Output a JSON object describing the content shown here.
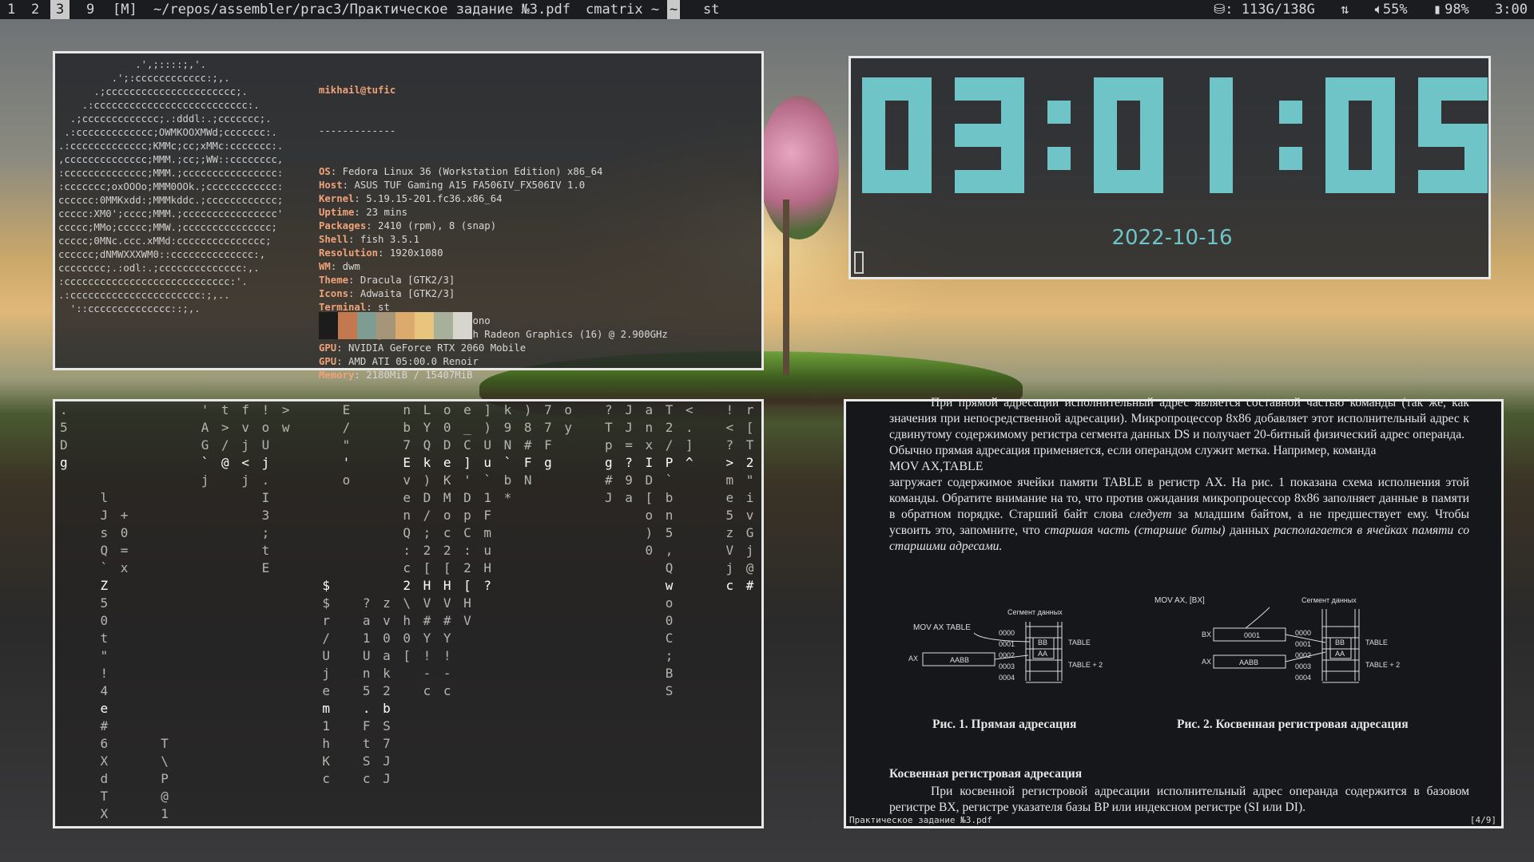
{
  "topbar": {
    "tags": [
      "1",
      "2",
      "3",
      "9"
    ],
    "selected_tag": "3",
    "layout": "[M]",
    "window_titles": [
      "~/repos/assembler/prac3/Практическое задание №3.pdf",
      "cmatrix ~",
      "~",
      "st"
    ],
    "selected_title": "~",
    "status": {
      "disk": "113G/138G",
      "volume": "55%",
      "battery": "98%",
      "time": "3:00"
    }
  },
  "neofetch": {
    "logo_lines": [
      "             .',;::::;,'.",
      "         .';:cccccccccccc:;,.",
      "      .;cccccccccccccccccccccc;.",
      "    .:cccccccccccccccccccccccccc:.",
      "  .;ccccccccccccc;.:dddl:.;ccccccc;.",
      " .:ccccccccccccc;OWMKOOXMWd;ccccccc:.",
      ".:ccccccccccccc;KMMc;cc;xMMc:ccccccc:.",
      ",cccccccccccccc;MMM.;cc;;WW::cccccccc,",
      ":cccccccccccccc;MMM.;cccccccccccccccc:",
      ":ccccccc;oxOOOo;MMM0OOk.;cccccccccccc:",
      "cccccc:0MMKxdd:;MMMkddc.;cccccccccccc;",
      "ccccc:XM0';cccc;MMM.;cccccccccccccccc'",
      "ccccc;MMo;ccccc;MMW.;ccccccccccccccc;",
      "ccccc;0MNc.ccc.xMMd:ccccccccccccccc;",
      "cccccc;dNMWXXXWM0::cccccccccccccc:,",
      "cccccccc;.:odl:.;cccccccccccccc:,.",
      ":cccccccccccccccccccccccccccc:'.",
      ".:cccccccccccccccccccccc:;,..",
      "  '::cccccccccccccc::;,."
    ],
    "user_host": "mikhail@tufic",
    "separator": "-------------",
    "fields": [
      {
        "key": "OS",
        "value": "Fedora Linux 36 (Workstation Edition) x86_64"
      },
      {
        "key": "Host",
        "value": "ASUS TUF Gaming A15 FA506IV_FX506IV 1.0"
      },
      {
        "key": "Kernel",
        "value": "5.19.15-201.fc36.x86_64"
      },
      {
        "key": "Uptime",
        "value": "23 mins"
      },
      {
        "key": "Packages",
        "value": "2410 (rpm), 8 (snap)"
      },
      {
        "key": "Shell",
        "value": "fish 3.5.1"
      },
      {
        "key": "Resolution",
        "value": "1920x1080"
      },
      {
        "key": "WM",
        "value": "dwm"
      },
      {
        "key": "Theme",
        "value": "Dracula [GTK2/3]"
      },
      {
        "key": "Icons",
        "value": "Adwaita [GTK2/3]"
      },
      {
        "key": "Terminal",
        "value": "st"
      },
      {
        "key": "Terminal Font",
        "value": "DejaVuSansMono"
      },
      {
        "key": "CPU",
        "value": "AMD Ryzen 7 4800H with Radeon Graphics (16) @ 2.900GHz"
      },
      {
        "key": "GPU",
        "value": "NVIDIA GeForce RTX 2060 Mobile"
      },
      {
        "key": "GPU",
        "value": "AMD ATI 05:00.0 Renoir"
      },
      {
        "key": "Memory",
        "value": "2180MiB / 15407MiB"
      }
    ],
    "palette": [
      "#1c1c1c",
      "#c3784d",
      "#7e9c91",
      "#a5967a",
      "#dcaa6c",
      "#e8c47c",
      "#a6b09a",
      "#d6d6ce"
    ]
  },
  "clock": {
    "time": "03:01:05",
    "date": "2022-10-16",
    "color": "#6fc4c7"
  },
  "matrix": {
    "columns": [
      ". 5 D g",
      "",
      "     l J s Q ` Z 5 0 t \" ! 4 e # 6 X d T X '",
      "      + 0 = x",
      "",
      "                   T \\ P @ 1 E \\",
      "",
      "' A G ` j",
      "t > / @",
      "f v j < j",
      "! o U j . I 3 ; t E",
      "> w",
      "",
      "          $ $ r / U j e m 1 h K c",
      "E / \" ' o",
      "           ? a 1 U n 5 . F t S c",
      "           z v 0 a k 2 b S 7 J J",
      "n b 7 E v e n Q : c 2 \\ h 0 [",
      "L Y Q k ) D / ; 2 [ H V # Y ! - c",
      "o 0 D e K M o c 2 [ H V # Y ! - c",
      "e _ C ] ' D p C : 2 [ H V",
      "] ) U u ` 1 F m u H ? ",
      "k 9 N ` b * ",
      ") 8 # F N",
      "7 7 F g",
      "o y",
      "",
      "? T p g # J",
      "J J = ? 9 a",
      "a n x I D [ o ) 0",
      "T 2 / P ` b n 5 , Q w o 0 C ; B S",
      "< . ] ^",
      "",
      "! < ? > m e 5 z V j c",
      "r [ T 2 \" i v G j @ #"
    ]
  },
  "pdf": {
    "para1": "При прямой адресации исполнительный адрес является составной частью команды (так же, как значения при непосредственной адресации). Микропроцессор 8x86 добавляет этот исполнительный адрес к сдвинутому содержимому регистра сегмента данных DS и получает 20-битный физический адрес операнда.",
    "para2": "Обычно прямая адресация применяется, если операндом служит метка. Например, команда",
    "mov": "MOV AX,TABLE",
    "para3_a": "загружает содержимое ячейки памяти TABLE в регистр AX. На рис. 1 показана схема исполнения этой команды. Обратите внимание на то, что против ожидания микропроцессор 8x86 заполняет данные в памяти в обратном порядке. Старший байт слова ",
    "para3_em1": "следует",
    "para3_b": " за младшим байтом, а не предшествует ему. Чтобы усвоить это, запомните, что ",
    "para3_em2": "старшая часть (старшие биты)",
    "para3_c": " данных ",
    "para3_em3": "располагается в ячейках памяти со старшими адресами.",
    "fig1": {
      "instr": "MOV   AX   TABLE",
      "segment": "Сегмент данных",
      "addrs": [
        "0000",
        "0001",
        "0002",
        "0003",
        "0004"
      ],
      "bb": "BB",
      "aa": "AA",
      "reg": "AX",
      "regval": "AABB",
      "label1": "TABLE",
      "label2": "TABLE + 2"
    },
    "fig2": {
      "instr": "MOV   AX,  [BX]",
      "segment": "Сегмент данных",
      "addrs": [
        "0000",
        "0001",
        "0002",
        "0003",
        "0004"
      ],
      "bb": "BB",
      "aa": "AA",
      "reg1": "BX",
      "reg1val": "0001",
      "reg2": "AX",
      "reg2val": "AABB",
      "label1": "TABLE",
      "label2": "TABLE + 2"
    },
    "caption1": "Рис. 1. Прямая адресация",
    "caption2": "Рис. 2. Косвенная регистровая адресация",
    "section": "Косвенная регистровая адресация",
    "para4": "При косвенной регистровой адресации исполнительный адрес операнда содержится в базовом регистре BX, регистре указателя базы BP или индексном регистре (SI или DI).",
    "status_file": "Практическое задание №3.pdf",
    "status_page": "[4/9]"
  }
}
